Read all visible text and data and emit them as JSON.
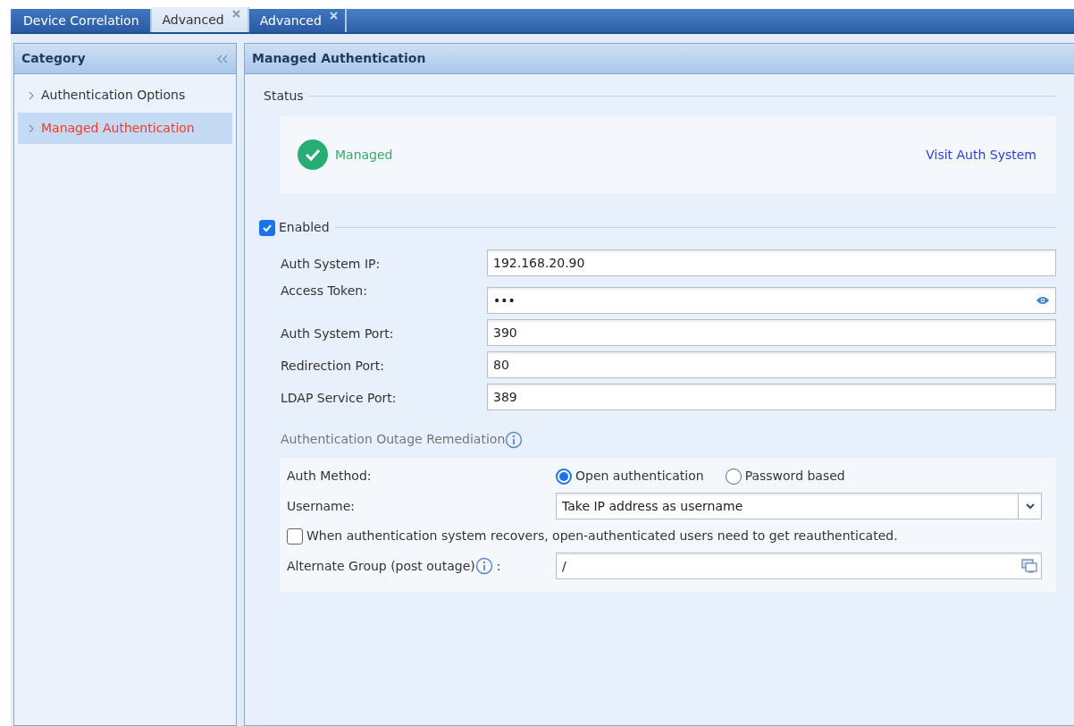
{
  "tabs": [
    {
      "label": "Device Correlation",
      "closable": false,
      "selected": false
    },
    {
      "label": "Advanced",
      "closable": true,
      "selected": true
    },
    {
      "label": "Advanced",
      "closable": true,
      "selected": false
    }
  ],
  "sidebar": {
    "title": "Category",
    "items": [
      {
        "label": "Authentication Options",
        "selected": false
      },
      {
        "label": "Managed Authentication",
        "selected": true
      }
    ]
  },
  "panel": {
    "title": "Managed Authentication",
    "status": {
      "legend": "Status",
      "state": "Managed",
      "link": "Visit Auth System"
    },
    "enabled": {
      "label": "Enabled",
      "checked": true
    },
    "fields": [
      {
        "label": "Auth System IP:",
        "value": "192.168.20.90",
        "kind": "text"
      },
      {
        "label": "Access Token:",
        "value": "•••",
        "kind": "secret"
      },
      {
        "label": "Auth System Port:",
        "value": "390",
        "kind": "text"
      },
      {
        "label": "Redirection Port:",
        "value": "80",
        "kind": "text"
      },
      {
        "label": "LDAP Service Port:",
        "value": "389",
        "kind": "text"
      }
    ],
    "outage": {
      "title": "Authentication Outage Remediation",
      "method_label": "Auth Method:",
      "methods": [
        {
          "label": "Open authentication",
          "selected": true
        },
        {
          "label": "Password based",
          "selected": false
        }
      ],
      "username_label": "Username:",
      "username_value": "Take IP address as username",
      "reauth": {
        "label": "When authentication system recovers, open-authenticated users need to get reauthenticated.",
        "checked": false
      },
      "group_label": "Alternate Group (post outage)",
      "group_colon": ":",
      "group_value": "/"
    }
  }
}
